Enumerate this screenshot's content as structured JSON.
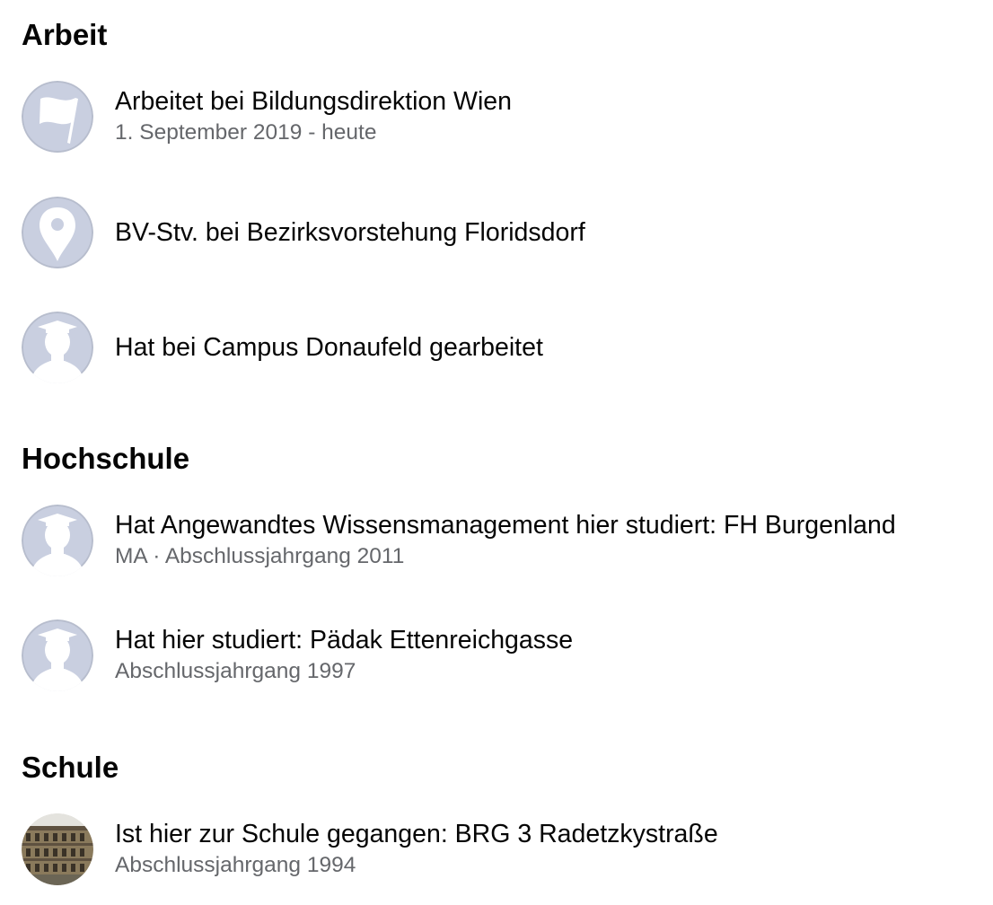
{
  "sections": {
    "work": {
      "title": "Arbeit",
      "items": [
        {
          "icon": "flag-icon",
          "main": "Arbeitet bei Bildungsdirektion Wien",
          "sub": "1. September 2019 - heute"
        },
        {
          "icon": "location-pin-icon",
          "main": "BV-Stv. bei Bezirksvorstehung Floridsdorf",
          "sub": ""
        },
        {
          "icon": "graduation-cap-icon",
          "main": "Hat bei Campus Donaufeld gearbeitet",
          "sub": ""
        }
      ]
    },
    "college": {
      "title": "Hochschule",
      "items": [
        {
          "icon": "graduation-cap-icon",
          "main": "Hat Angewandtes Wissensmanagement hier studiert: FH Burgenland",
          "sub": "MA · Abschlussjahrgang 2011"
        },
        {
          "icon": "graduation-cap-icon",
          "main": "Hat hier studiert: Pädak Ettenreichgasse",
          "sub": "Abschlussjahrgang 1997"
        }
      ]
    },
    "school": {
      "title": "Schule",
      "items": [
        {
          "icon": "school-building-photo",
          "main": "Ist hier zur Schule gegangen: BRG 3 Radetzkystraße",
          "sub": "Abschlussjahrgang 1994"
        }
      ]
    }
  },
  "colors": {
    "icon_background": "#c9cfe0",
    "icon_foreground": "#ffffff",
    "primary_text": "#050505",
    "secondary_text": "#65676b"
  }
}
